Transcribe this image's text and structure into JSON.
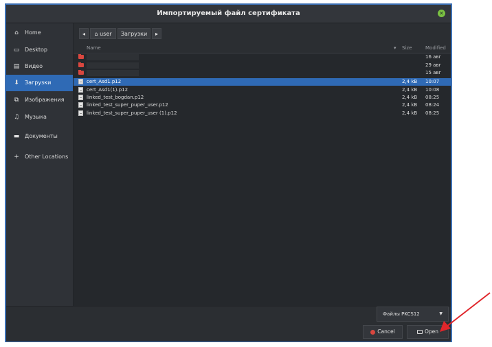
{
  "window": {
    "title": "Импортируемый файл сертификата",
    "close_icon": "close-icon"
  },
  "sidebar": {
    "items": [
      {
        "label": "Home",
        "icon": "home-icon"
      },
      {
        "label": "Desktop",
        "icon": "desktop-icon"
      },
      {
        "label": "Видео",
        "icon": "video-icon"
      },
      {
        "label": "Загрузки",
        "icon": "download-icon",
        "active": true
      },
      {
        "label": "Изображения",
        "icon": "image-icon"
      },
      {
        "label": "Музыка",
        "icon": "music-icon"
      },
      {
        "label": "Документы",
        "icon": "folder-icon"
      },
      {
        "label": "Other Locations",
        "icon": "plus-icon"
      }
    ]
  },
  "pathbar": {
    "back": "◂",
    "forward": "▸",
    "crumbs": [
      "user",
      "Загрузки"
    ]
  },
  "columns": {
    "name": "Name",
    "size": "Size",
    "modified": "Modified"
  },
  "files": [
    {
      "type": "folder",
      "name": "",
      "size": "",
      "modified": "16 авг"
    },
    {
      "type": "folder",
      "name": "",
      "size": "",
      "modified": "29 авг"
    },
    {
      "type": "folder",
      "name": "",
      "size": "",
      "modified": "15 авг"
    },
    {
      "type": "file",
      "name": "cert_Asd1.p12",
      "size": "2,4 kB",
      "modified": "10:07",
      "selected": true
    },
    {
      "type": "file",
      "name": "cert_Asd1(1).p12",
      "size": "2,4 kB",
      "modified": "10:08"
    },
    {
      "type": "file",
      "name": "linked_test_bogdan.p12",
      "size": "2,4 kB",
      "modified": "08:25"
    },
    {
      "type": "file",
      "name": "linked_test_super_puper_user.p12",
      "size": "2,4 kB",
      "modified": "08:24"
    },
    {
      "type": "file",
      "name": "linked_test_super_puper_user (1).p12",
      "size": "2,4 kB",
      "modified": "08:25"
    }
  ],
  "filter": {
    "label": "Файлы PKCS12"
  },
  "buttons": {
    "cancel": "Cancel",
    "open": "Open"
  },
  "colors": {
    "accent": "#2f6ab5",
    "annotation_arrow": "#e0262b"
  }
}
